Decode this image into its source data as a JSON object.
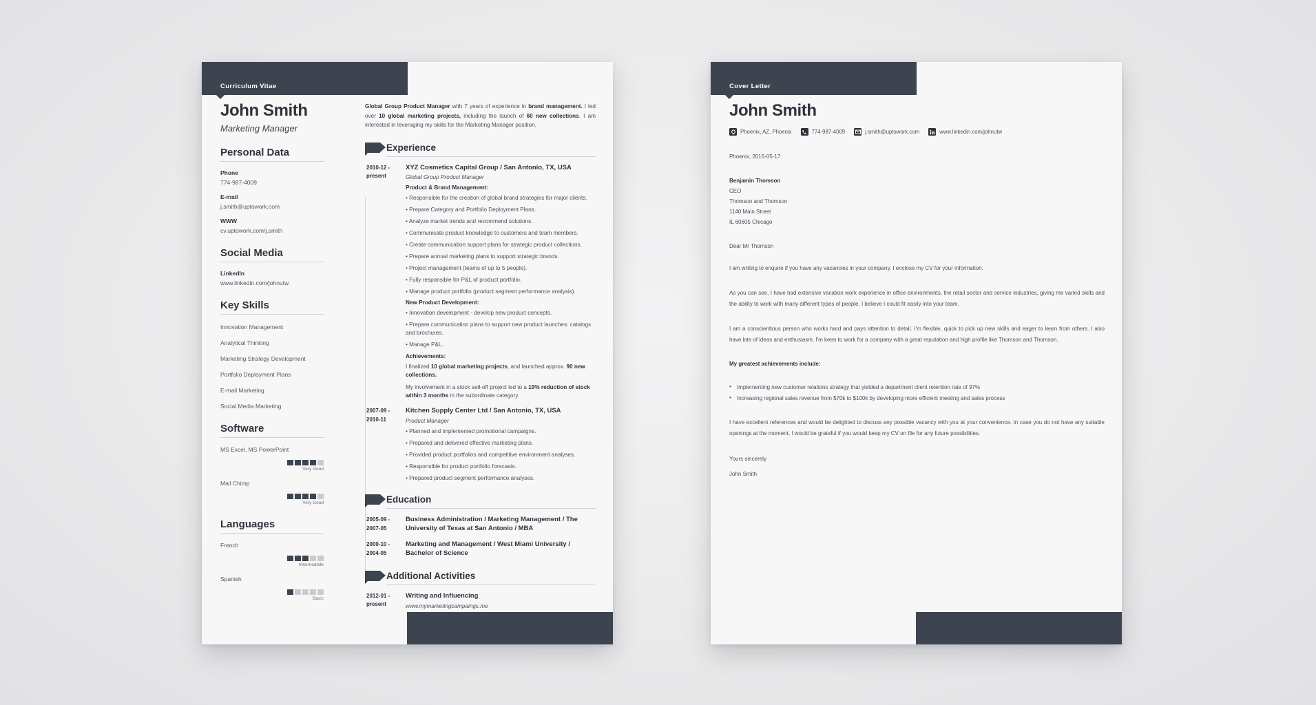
{
  "cv": {
    "header_label": "Curriculum Vitae",
    "name": "John Smith",
    "role": "Marketing Manager",
    "sections": {
      "personal_data": "Personal Data",
      "social_media": "Social Media",
      "key_skills": "Key Skills",
      "software": "Software",
      "languages": "Languages",
      "experience": "Experience",
      "education": "Education",
      "additional_activities": "Additional Activities"
    },
    "personal_data": [
      {
        "label": "Phone",
        "value": "774-987-4009"
      },
      {
        "label": "E-mail",
        "value": "j.smith@uptowork.com"
      },
      {
        "label": "WWW",
        "value": "cv.uptowork.com/j.smith"
      }
    ],
    "social_media": [
      {
        "label": "LinkedIn",
        "value": "www.linkedin.com/johnutw"
      }
    ],
    "key_skills": [
      "Innovation Management",
      "Analytical Thinking",
      "Marketing Strategy Development",
      "Portfolio Deployment Plans",
      "E-mail Marketing",
      "Social Media Marketing"
    ],
    "software": [
      {
        "name": "MS Excel, MS PowerPoint",
        "filled": 4,
        "total": 5,
        "level": "Very Good"
      },
      {
        "name": "Mail Chimp",
        "filled": 4,
        "total": 5,
        "level": "Very Good"
      }
    ],
    "languages": [
      {
        "name": "French",
        "filled": 3,
        "total": 5,
        "level": "Intermediate"
      },
      {
        "name": "Spanish",
        "filled": 1,
        "total": 5,
        "level": "Basic"
      }
    ],
    "summary_html": "<b>Global Group Product Manager</b> with 7 years of experience in <b>brand management.</b> I led over <b>10 global marketing projects,</b> including the launch of <b>60 new collections</b>. I am interested in leveraging my skills for the Marketing Manager position.",
    "experience": [
      {
        "date": "2010-12 - present",
        "title": "XYZ Cosmetics Capital Group / San Antonio, TX, USA",
        "subtitle": "Global Group Product Manager",
        "blocks": [
          {
            "type": "head",
            "text": "Product & Brand Management:"
          },
          {
            "type": "bullet",
            "text": "Responsible for the creation of global brand strategies for major clients."
          },
          {
            "type": "bullet",
            "text": "Prepare Category and Portfolio Deployment Plans."
          },
          {
            "type": "bullet",
            "text": "Analyze market trends and recommend solutions."
          },
          {
            "type": "bullet",
            "text": "Communicate product knowledge to customers and team members."
          },
          {
            "type": "bullet",
            "text": "Create communication support plans for strategic product collections."
          },
          {
            "type": "bullet",
            "text": "Prepare annual marketing plans to support strategic brands."
          },
          {
            "type": "bullet",
            "text": "Project management (teams of up to 5 people)."
          },
          {
            "type": "bullet",
            "text": "Fully responsible for P&L of product portfolio."
          },
          {
            "type": "bullet",
            "text": "Manage product portfolio (product segment performance analysis)."
          },
          {
            "type": "head",
            "text": "New Product Development:"
          },
          {
            "type": "bullet",
            "text": "Innovation development - develop new product concepts."
          },
          {
            "type": "bullet",
            "text": "Prepare communication plans to support new product launches: catalogs and brochures."
          },
          {
            "type": "bullet",
            "text": "Manage P&L."
          },
          {
            "type": "head",
            "text": "Achievements:"
          },
          {
            "type": "para",
            "html": "I finalized <b>10 global marketing projects</b>, and launched approx. <b>90 new collections.</b>"
          },
          {
            "type": "para",
            "html": "My involvement in a stock sell-off project led to a <b>19% reduction of stock within 3 months</b> in the subordinate category."
          }
        ]
      },
      {
        "date": "2007-09 - 2010-11",
        "title": "Kitchen Supply Center Ltd / San Antonio, TX, USA",
        "subtitle": "Product Manager",
        "blocks": [
          {
            "type": "bullet",
            "text": "Planned and implemented promotional campaigns."
          },
          {
            "type": "bullet",
            "text": "Prepared and delivered effective marketing plans."
          },
          {
            "type": "bullet",
            "text": "Provided product portfolios and competitive environment analyses."
          },
          {
            "type": "bullet",
            "text": "Responsible for product portfolio forecasts."
          },
          {
            "type": "bullet",
            "text": "Prepared product segment performance analyses."
          }
        ]
      }
    ],
    "education": [
      {
        "date": "2005-09 - 2007-05",
        "title": "Business Administration / Marketing Management / The University of Texas at San Antonio / MBA"
      },
      {
        "date": "2000-10 - 2004-05",
        "title": "Marketing and Management / West Miami University / Bachelor of Science"
      }
    ],
    "additional_activities": [
      {
        "date": "2012-01 - present",
        "title": "Writing and Influencing",
        "subtitle": "www.mymarketingcampaings.me"
      }
    ]
  },
  "cover_letter": {
    "header_label": "Cover Letter",
    "name": "John Smith",
    "contacts": [
      {
        "icon": "location-icon",
        "text": "Phoenix, AZ, Phoenix"
      },
      {
        "icon": "phone-icon",
        "text": "774-987-4009"
      },
      {
        "icon": "email-icon",
        "text": "j.smith@uptowork.com"
      },
      {
        "icon": "linkedin-icon",
        "text": "www.linkedin.com/johnutw"
      }
    ],
    "date_line": "Phoenix, 2016-05-17",
    "recipient": [
      {
        "text": "Benjamin Thomson",
        "bold": true
      },
      {
        "text": "CEO",
        "bold": false
      },
      {
        "text": "Thomson and Thomson",
        "bold": false
      },
      {
        "text": "1140 Main Street",
        "bold": false
      },
      {
        "text": "IL 60605 Chicago",
        "bold": false
      }
    ],
    "salutation": "Dear Mr Thomson",
    "paragraphs": [
      "I am writing to enquire if you have any vacancies in your company. I enclose my CV for your information.",
      "As you can see, I have had extensive vacation work experience in office environments, the retail sector and service industries, giving me varied skills and the ability to work with many different types of people. I believe I could fit easily into your team.",
      "I am a conscientious person who works hard and pays attention to detail. I'm flexible, quick to pick up new skills and eager to learn from others. I also have lots of ideas and enthusiasm. I'm keen to work for a company with a great reputation and high profile like Thomson and Thomson."
    ],
    "achievements_heading": "My greatest achievements include:",
    "achievements": [
      "Implementing new customer relations strategy that yielded a department client retention rate of 97%",
      "Increasing regional sales revenue from $70k to $100k by developing more efficient meeting and sales process"
    ],
    "closing_paragraph": "I have excellent references and would be delighted to discuss any possible vacancy with you at your convenience. In case you do not have any suitable openings at the moment, I would be grateful if you would keep my CV on file for any future possibilities.",
    "sign_off": "Yours sincerely",
    "sign_name": "John Smith"
  },
  "colors": {
    "dark": "#3d4450",
    "text": "#4a4f57",
    "heading": "#2f333b",
    "rule": "#cfd1d5",
    "block_off": "#c9cbcf"
  }
}
